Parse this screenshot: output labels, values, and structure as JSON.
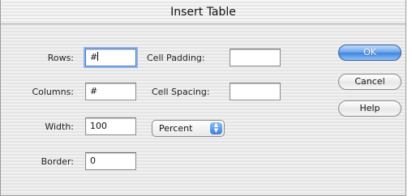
{
  "dialog": {
    "title": "Insert Table",
    "rows_label": "Rows:",
    "rows_value": "#",
    "columns_label": "Columns:",
    "columns_value": "#",
    "width_label": "Width:",
    "width_value": "100",
    "width_unit": "Percent",
    "border_label": "Border:",
    "border_value": "0",
    "cell_padding_label": "Cell Padding:",
    "cell_padding_value": "",
    "cell_spacing_label": "Cell Spacing:",
    "cell_spacing_value": ""
  },
  "buttons": {
    "ok": "OK",
    "cancel": "Cancel",
    "help": "Help"
  },
  "icons": {
    "popup_arrow": "up-down-arrows-icon"
  },
  "colors": {
    "accent": "#3e85e0",
    "focus_ring": "#8fb4e6"
  }
}
